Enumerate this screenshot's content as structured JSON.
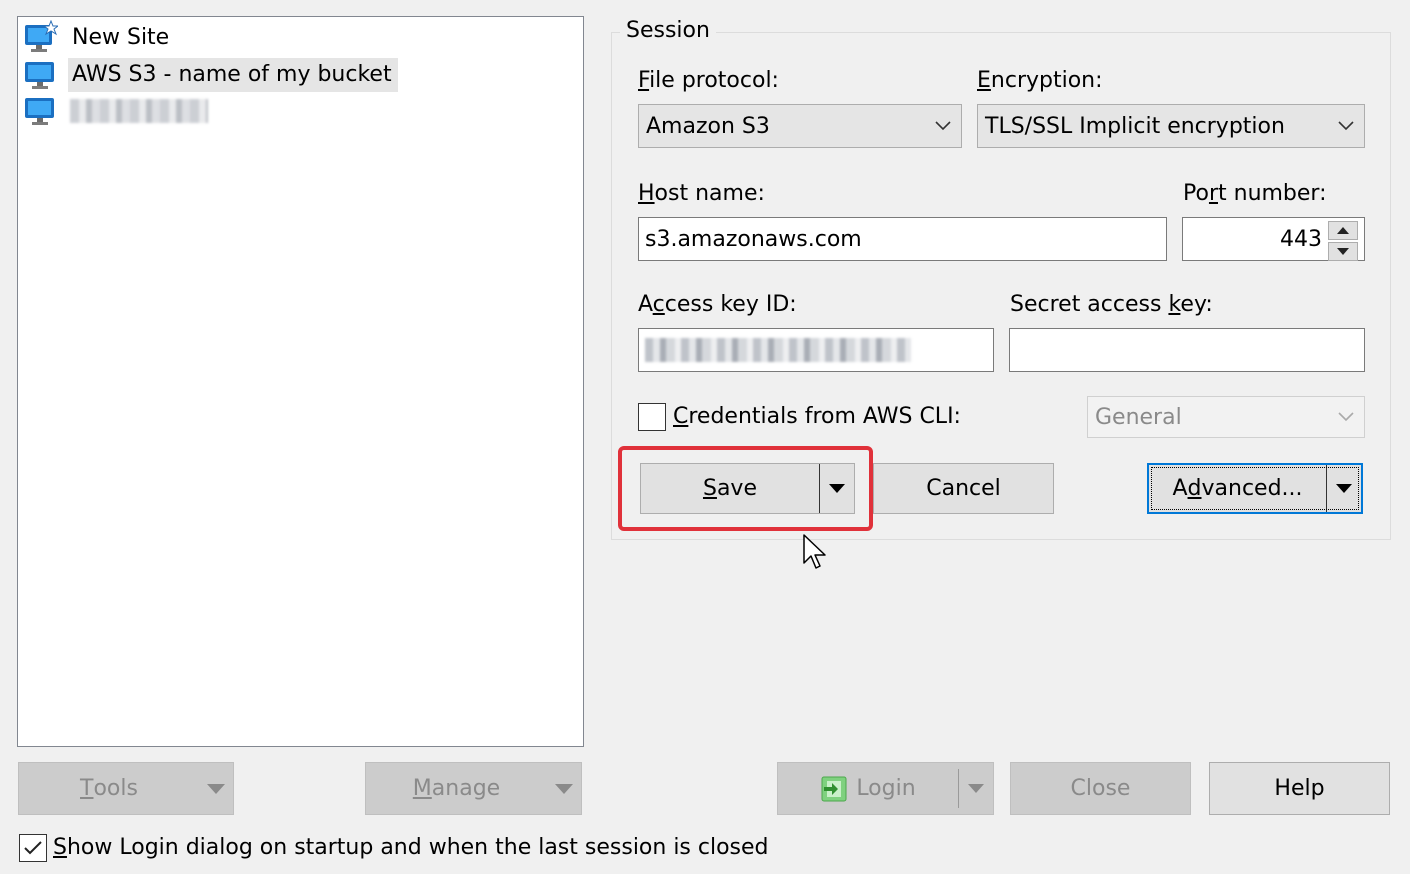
{
  "sites": {
    "items": [
      {
        "label": "New Site",
        "selected": false
      },
      {
        "label": "AWS S3 - name of my bucket",
        "selected": true
      },
      {
        "label": "",
        "selected": false
      }
    ]
  },
  "session": {
    "group_label": "Session",
    "file_protocol": {
      "label": "File protocol:",
      "value": "Amazon S3"
    },
    "encryption": {
      "label": "Encryption:",
      "value": "TLS/SSL Implicit encryption"
    },
    "host_name": {
      "label": "Host name:",
      "value": "s3.amazonaws.com"
    },
    "port_number": {
      "label": "Port number:",
      "value": "443"
    },
    "access_key_id": {
      "label": "Access key ID:",
      "value": ""
    },
    "secret_access_key": {
      "label": "Secret access key:",
      "value": ""
    },
    "credentials_cli": {
      "label": "Credentials from AWS CLI:",
      "checked": false,
      "profile": "General"
    },
    "buttons": {
      "save": "Save",
      "cancel": "Cancel",
      "advanced": "Advanced..."
    }
  },
  "footer": {
    "tools": "Tools",
    "manage": "Manage",
    "login": "Login",
    "close": "Close",
    "help": "Help",
    "show_login_label": "Show Login dialog on startup and when the last session is closed",
    "show_login_checked": true
  },
  "colors": {
    "highlight": "#e0313a",
    "focus": "#0078d7"
  }
}
